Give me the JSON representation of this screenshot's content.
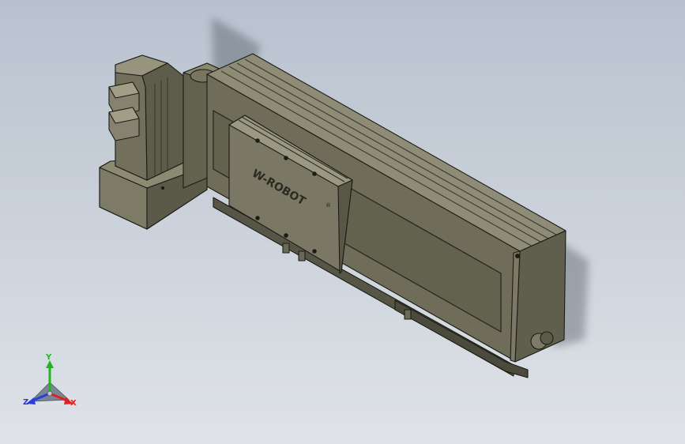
{
  "viewport": {
    "background_top": "#b8c2cf",
    "background_bottom": "#dfe3e8"
  },
  "model": {
    "brand_text": "W-ROBOT",
    "registered_mark": "®",
    "body_color": "#6e6c58",
    "body_light": "#8a8871",
    "body_dark": "#4a493c",
    "edge_color": "#1c1c16"
  },
  "triad": {
    "x_label": "X",
    "y_label": "Y",
    "z_label": "Z",
    "x_color": "#e02020",
    "y_color": "#22b522",
    "z_color": "#2a3fd8"
  }
}
